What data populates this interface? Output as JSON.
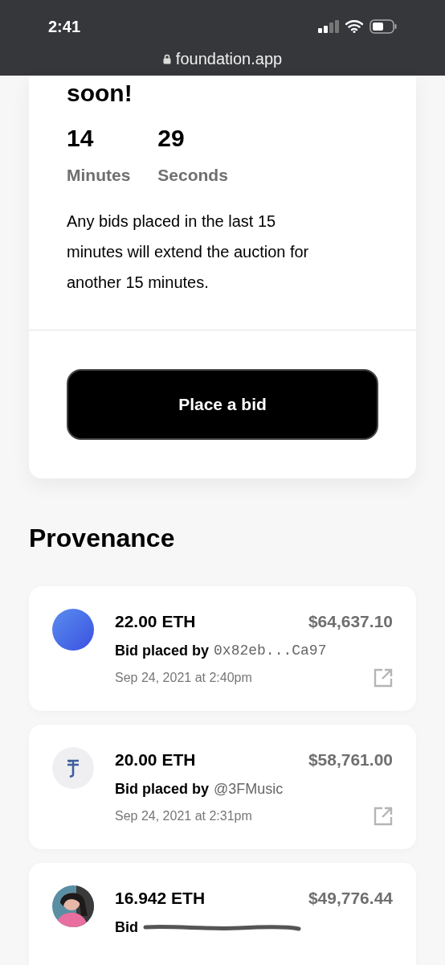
{
  "status_bar": {
    "time": "2:41"
  },
  "address_bar": {
    "url": "foundation.app",
    "secure": true
  },
  "auction": {
    "heading": "soon!",
    "countdown": [
      {
        "value": "14",
        "unit": "Minutes"
      },
      {
        "value": "29",
        "unit": "Seconds"
      }
    ],
    "note": "Any bids placed in the last 15 minutes will extend the auction for another 15 minutes.",
    "button": "Place a bid"
  },
  "provenance": {
    "title": "Provenance",
    "bids": [
      {
        "avatar": {
          "kind": "gradient"
        },
        "amount": "22.00 ETH",
        "usd": "$64,637.10",
        "prefix": "Bid placed by",
        "bidder": {
          "kind": "address",
          "name": "0x82eb...Ca97"
        },
        "date": "Sep 24, 2021 at 2:40pm",
        "redacted": false
      },
      {
        "avatar": {
          "kind": "logo"
        },
        "amount": "20.00 ETH",
        "usd": "$58,761.00",
        "prefix": "Bid placed by",
        "bidder": {
          "kind": "handle",
          "name": "@3FMusic"
        },
        "date": "Sep 24, 2021 at 2:31pm",
        "redacted": false
      },
      {
        "amount": "16.942 ETH",
        "usd": "$49,776.44",
        "prefix": "Bid",
        "redacted": true
      }
    ]
  }
}
